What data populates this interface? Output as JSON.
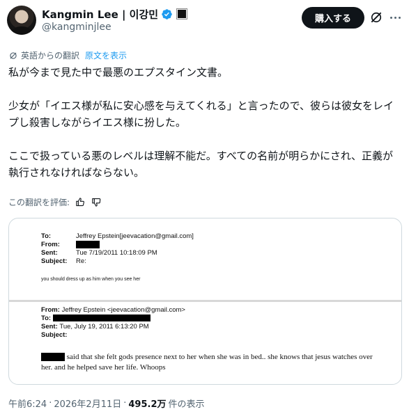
{
  "author": {
    "display_name": "Kangmin Lee | 이강민",
    "handle": "@kangminjlee",
    "verified": true
  },
  "actions": {
    "buy_label": "購入する",
    "grok_icon": "grok-slash-icon",
    "more_icon": "more-icon"
  },
  "translation": {
    "note": "英語からの翻訳",
    "show_original": "原文を表示",
    "rate_label": "この翻訳を評価:"
  },
  "tweet": {
    "line1": "私が今まで見た中で最悪のエプスタイン文書。",
    "line2": "少女が「イエス様が私に安心感を与えてくれる」と言ったので、彼らは彼女をレイプし殺害しながらイエス様に扮した。",
    "line3": "ここで扱っている悪のレベルは理解不能だ。すべての名前が明らかにされ、正義が執行されなければならない。"
  },
  "document": {
    "email1": {
      "to_label": "To:",
      "to_value": "Jeffrey Epstein[jeevacation@gmail.com]",
      "from_label": "From:",
      "sent_label": "Sent:",
      "sent_value": "Tue 7/19/2011 10:18:09 PM",
      "subject_label": "Subject:",
      "subject_value": "Re:",
      "body": "you should dress up as him when you see her"
    },
    "email2": {
      "from_label": "From:",
      "from_value": "Jeffrey Epstein <jeevacation@gmail.com>",
      "to_label": "To:",
      "sent_label": "Sent:",
      "sent_value": "Tue, July 19, 2011 6:13:20 PM",
      "subject_label": "Subject:",
      "body": "said that she felt gods presence next to her when she was in bed..  she knows that jesus watches over her.  and he helped save her life.    Whoops"
    }
  },
  "meta": {
    "time": "午前6:24",
    "separator": "·",
    "date": "2026年2月11日",
    "views_count": "495.2万",
    "views_label": "件の表示"
  },
  "colors": {
    "accent": "#1d9bf0",
    "text": "#0f1419",
    "muted": "#536471",
    "border": "#cfd9de"
  }
}
